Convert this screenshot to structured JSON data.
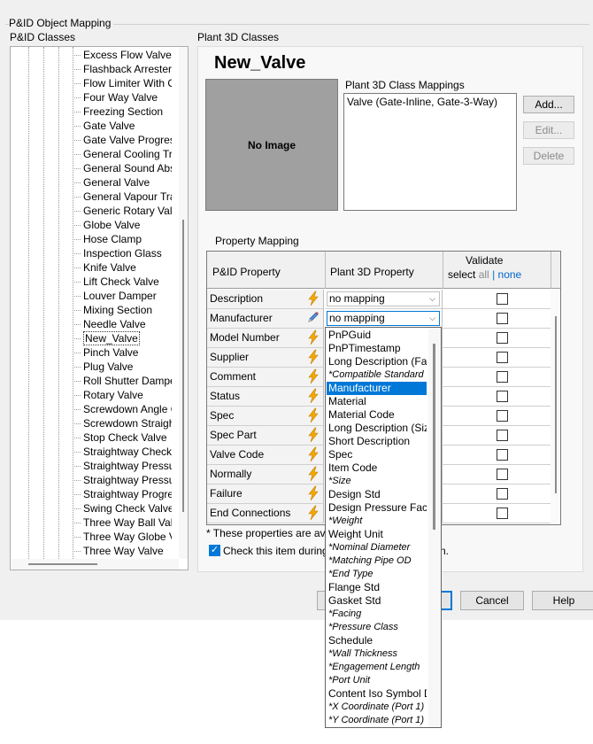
{
  "dialog": {
    "group_title": "P&ID Object Mapping",
    "left_title": "P&ID Classes",
    "right_title": "Plant 3D Classes"
  },
  "tree": {
    "selected": "New_Valve",
    "items": [
      "Excess Flow Valve",
      "Flashback Arrester",
      "Flow Limiter With Orifice",
      "Four Way Valve",
      "Freezing Section",
      "Gate Valve",
      "Gate Valve Progressive",
      "General Cooling Trap",
      "General Sound Absorber",
      "General Valve",
      "General Vapour Trap",
      "Generic Rotary Valve",
      "Globe Valve",
      "Hose Clamp",
      "Inspection Glass",
      "Knife Valve",
      "Lift Check Valve",
      "Louver Damper",
      "Mixing Section",
      "Needle Valve",
      "New_Valve",
      "Pinch Valve",
      "Plug Valve",
      "Roll Shutter Damper",
      "Rotary Valve",
      "Screwdown Angle Check",
      "Screwdown Straightway",
      "Stop Check Valve",
      "Straightway Check Valve",
      "Straightway Pressure",
      "Straightway Pressure",
      "Straightway Progressive",
      "Swing Check Valve",
      "Three Way Ball Valve",
      "Three Way Globe Valve",
      "Three Way Valve"
    ]
  },
  "plant3d": {
    "class_name": "New_Valve",
    "no_image_label": "No Image",
    "mappings_label": "Plant 3D Class Mappings",
    "mapping_item": "Valve (Gate-Inline, Gate-3-Way)",
    "buttons": {
      "add": "Add...",
      "edit": "Edit...",
      "delete": "Delete"
    }
  },
  "property_mapping": {
    "title": "Property Mapping",
    "headers": {
      "pid_property": "P&ID Property",
      "plant_property": "Plant 3D Property",
      "validate": "Validate",
      "select": "select",
      "all": "all",
      "pipe": "|",
      "none": "none"
    },
    "rows": [
      {
        "name": "Description",
        "icon": "lightning-icon",
        "value": "no mapping",
        "combo": true
      },
      {
        "name": "Manufacturer",
        "icon": "pencil-icon",
        "value": "no mapping",
        "combo": true
      },
      {
        "name": "Model Number",
        "icon": "lightning-icon",
        "value": "",
        "combo": false
      },
      {
        "name": "Supplier",
        "icon": "lightning-icon",
        "value": "",
        "combo": false
      },
      {
        "name": "Comment",
        "icon": "lightning-icon",
        "value": "",
        "combo": false
      },
      {
        "name": "Status",
        "icon": "lightning-icon",
        "value": "",
        "combo": false
      },
      {
        "name": "Spec",
        "icon": "lightning-icon",
        "value": "",
        "combo": false
      },
      {
        "name": "Spec Part",
        "icon": "lightning-icon",
        "value": "",
        "combo": false
      },
      {
        "name": "Valve Code",
        "icon": "lightning-icon",
        "value": "",
        "combo": false
      },
      {
        "name": "Normally",
        "icon": "lightning-icon",
        "value": "",
        "combo": false
      },
      {
        "name": "Failure",
        "icon": "lightning-icon",
        "value": "",
        "combo": false
      },
      {
        "name": "End Connections",
        "icon": "lightning-icon",
        "value": "",
        "combo": false
      }
    ],
    "footnote_left": "* These properties are ava",
    "checkbox_left": "Check this item during",
    "checkbox_right": "n.",
    "checkbox_checked": true
  },
  "dropdown": {
    "selected": "Manufacturer",
    "items": [
      {
        "text": "PnPGuid",
        "italic": false
      },
      {
        "text": "PnPTimestamp",
        "italic": false
      },
      {
        "text": "Long Description (Family)",
        "italic": false
      },
      {
        "text": "*Compatible Standard",
        "italic": true
      },
      {
        "text": "Manufacturer",
        "italic": false
      },
      {
        "text": "Material",
        "italic": false
      },
      {
        "text": "Material Code",
        "italic": false
      },
      {
        "text": "Long Description (Size)",
        "italic": false
      },
      {
        "text": "Short Description",
        "italic": false
      },
      {
        "text": "Spec",
        "italic": false
      },
      {
        "text": "Item Code",
        "italic": false
      },
      {
        "text": "*Size",
        "italic": true
      },
      {
        "text": "Design Std",
        "italic": false
      },
      {
        "text": "Design Pressure Factor",
        "italic": false
      },
      {
        "text": "*Weight",
        "italic": true
      },
      {
        "text": "Weight Unit",
        "italic": false
      },
      {
        "text": "*Nominal Diameter",
        "italic": true
      },
      {
        "text": "*Matching Pipe OD",
        "italic": true
      },
      {
        "text": "*End Type",
        "italic": true
      },
      {
        "text": "Flange Std",
        "italic": false
      },
      {
        "text": "Gasket Std",
        "italic": false
      },
      {
        "text": "*Facing",
        "italic": true
      },
      {
        "text": "*Pressure Class",
        "italic": true
      },
      {
        "text": "Schedule",
        "italic": false
      },
      {
        "text": "*Wall Thickness",
        "italic": true
      },
      {
        "text": "*Engagement Length",
        "italic": true
      },
      {
        "text": "*Port Unit",
        "italic": true
      },
      {
        "text": "Content Iso Symbol Definition",
        "italic": false
      },
      {
        "text": "*X Coordinate (Port 1)",
        "italic": true
      },
      {
        "text": "*Y Coordinate (Port 1)",
        "italic": true
      }
    ]
  },
  "footer_buttons": {
    "cancel": "Cancel",
    "help": "Help"
  }
}
